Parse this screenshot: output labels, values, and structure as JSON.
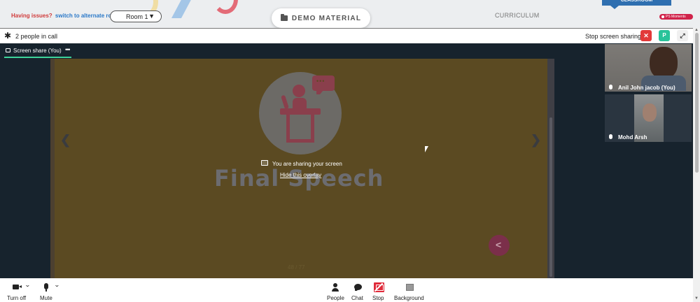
{
  "topbar": {
    "issues_text": "Having issues?",
    "alternate_room_link": "switch to alternate room",
    "room_select_value": "Room 1",
    "demo_material_label": "DEMO MATERIAL",
    "curriculum_label": "CURRICULUM",
    "classroom_label": "CLASSROOM",
    "moments_label": "PS Moments"
  },
  "call_header": {
    "people_count": "2 people in call",
    "stop_sharing_label": "Stop screen sharing",
    "close_symbol": "✕",
    "participant_badge": "P",
    "expand_symbol": "⤢"
  },
  "share_tab": {
    "label": "Screen share (You)",
    "more_symbol": "•••"
  },
  "slide": {
    "title": "Final Speech",
    "page_indicator": "48 / 77",
    "prev_symbol": "❮",
    "next_symbol": "❯"
  },
  "overlay": {
    "message": "You are sharing your screen",
    "hide_link": "Hide this overlay"
  },
  "participants": [
    {
      "name": "Anil John jacob (You)"
    },
    {
      "name": "Mohd Arsh"
    }
  ],
  "toolbar": {
    "camera_label": "Turn off",
    "mic_label": "Mute",
    "people_label": "People",
    "chat_label": "Chat",
    "stop_label": "Stop",
    "background_label": "Background",
    "caret_symbol": "⌄"
  },
  "colors": {
    "slide_background": "#5b4a22",
    "stage_background": "#17232d",
    "accent_green": "#3dd39a",
    "stop_red": "#e02a3a",
    "brand_red": "#d03a3a",
    "link_blue": "#2a78c8"
  },
  "icons": [
    "gear-icon",
    "folder-icon",
    "screen-share-icon",
    "microphone-icon",
    "camera-icon",
    "person-icon",
    "chat-icon",
    "stop-share-icon",
    "background-icon",
    "share-icon",
    "cursor-icon"
  ]
}
